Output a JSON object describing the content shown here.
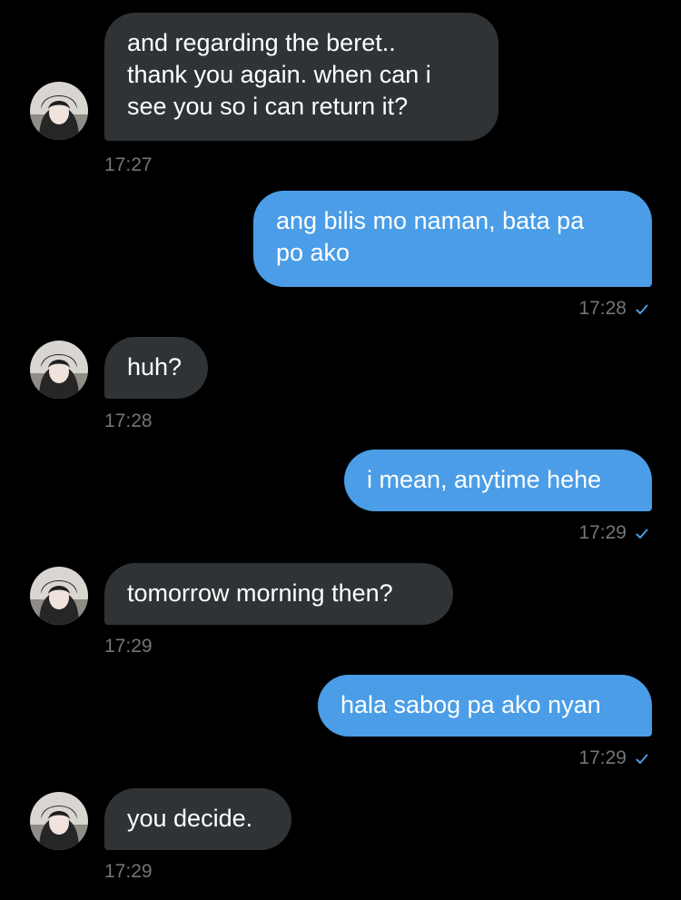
{
  "colors": {
    "background": "#000000",
    "incoming_bubble": "#2f3336",
    "outgoing_bubble": "#4a9de6",
    "timestamp": "#71767b",
    "read_check": "#4a9de6"
  },
  "messages": [
    {
      "direction": "incoming",
      "text": "and regarding the beret..\nthank you again. when can i\nsee you so i can return it?",
      "time": "17:27"
    },
    {
      "direction": "outgoing",
      "text": "ang bilis mo naman, bata pa\npo ako",
      "time": "17:28",
      "status_icon": "check-icon"
    },
    {
      "direction": "incoming",
      "text": "huh?",
      "time": "17:28"
    },
    {
      "direction": "outgoing",
      "text": "i mean, anytime hehe",
      "time": "17:29",
      "status_icon": "check-icon"
    },
    {
      "direction": "incoming",
      "text": "tomorrow morning then?",
      "time": "17:29"
    },
    {
      "direction": "outgoing",
      "text": "hala sabog pa ako nyan",
      "time": "17:29",
      "status_icon": "check-icon"
    },
    {
      "direction": "incoming",
      "text": "you decide.",
      "time": "17:29"
    }
  ]
}
